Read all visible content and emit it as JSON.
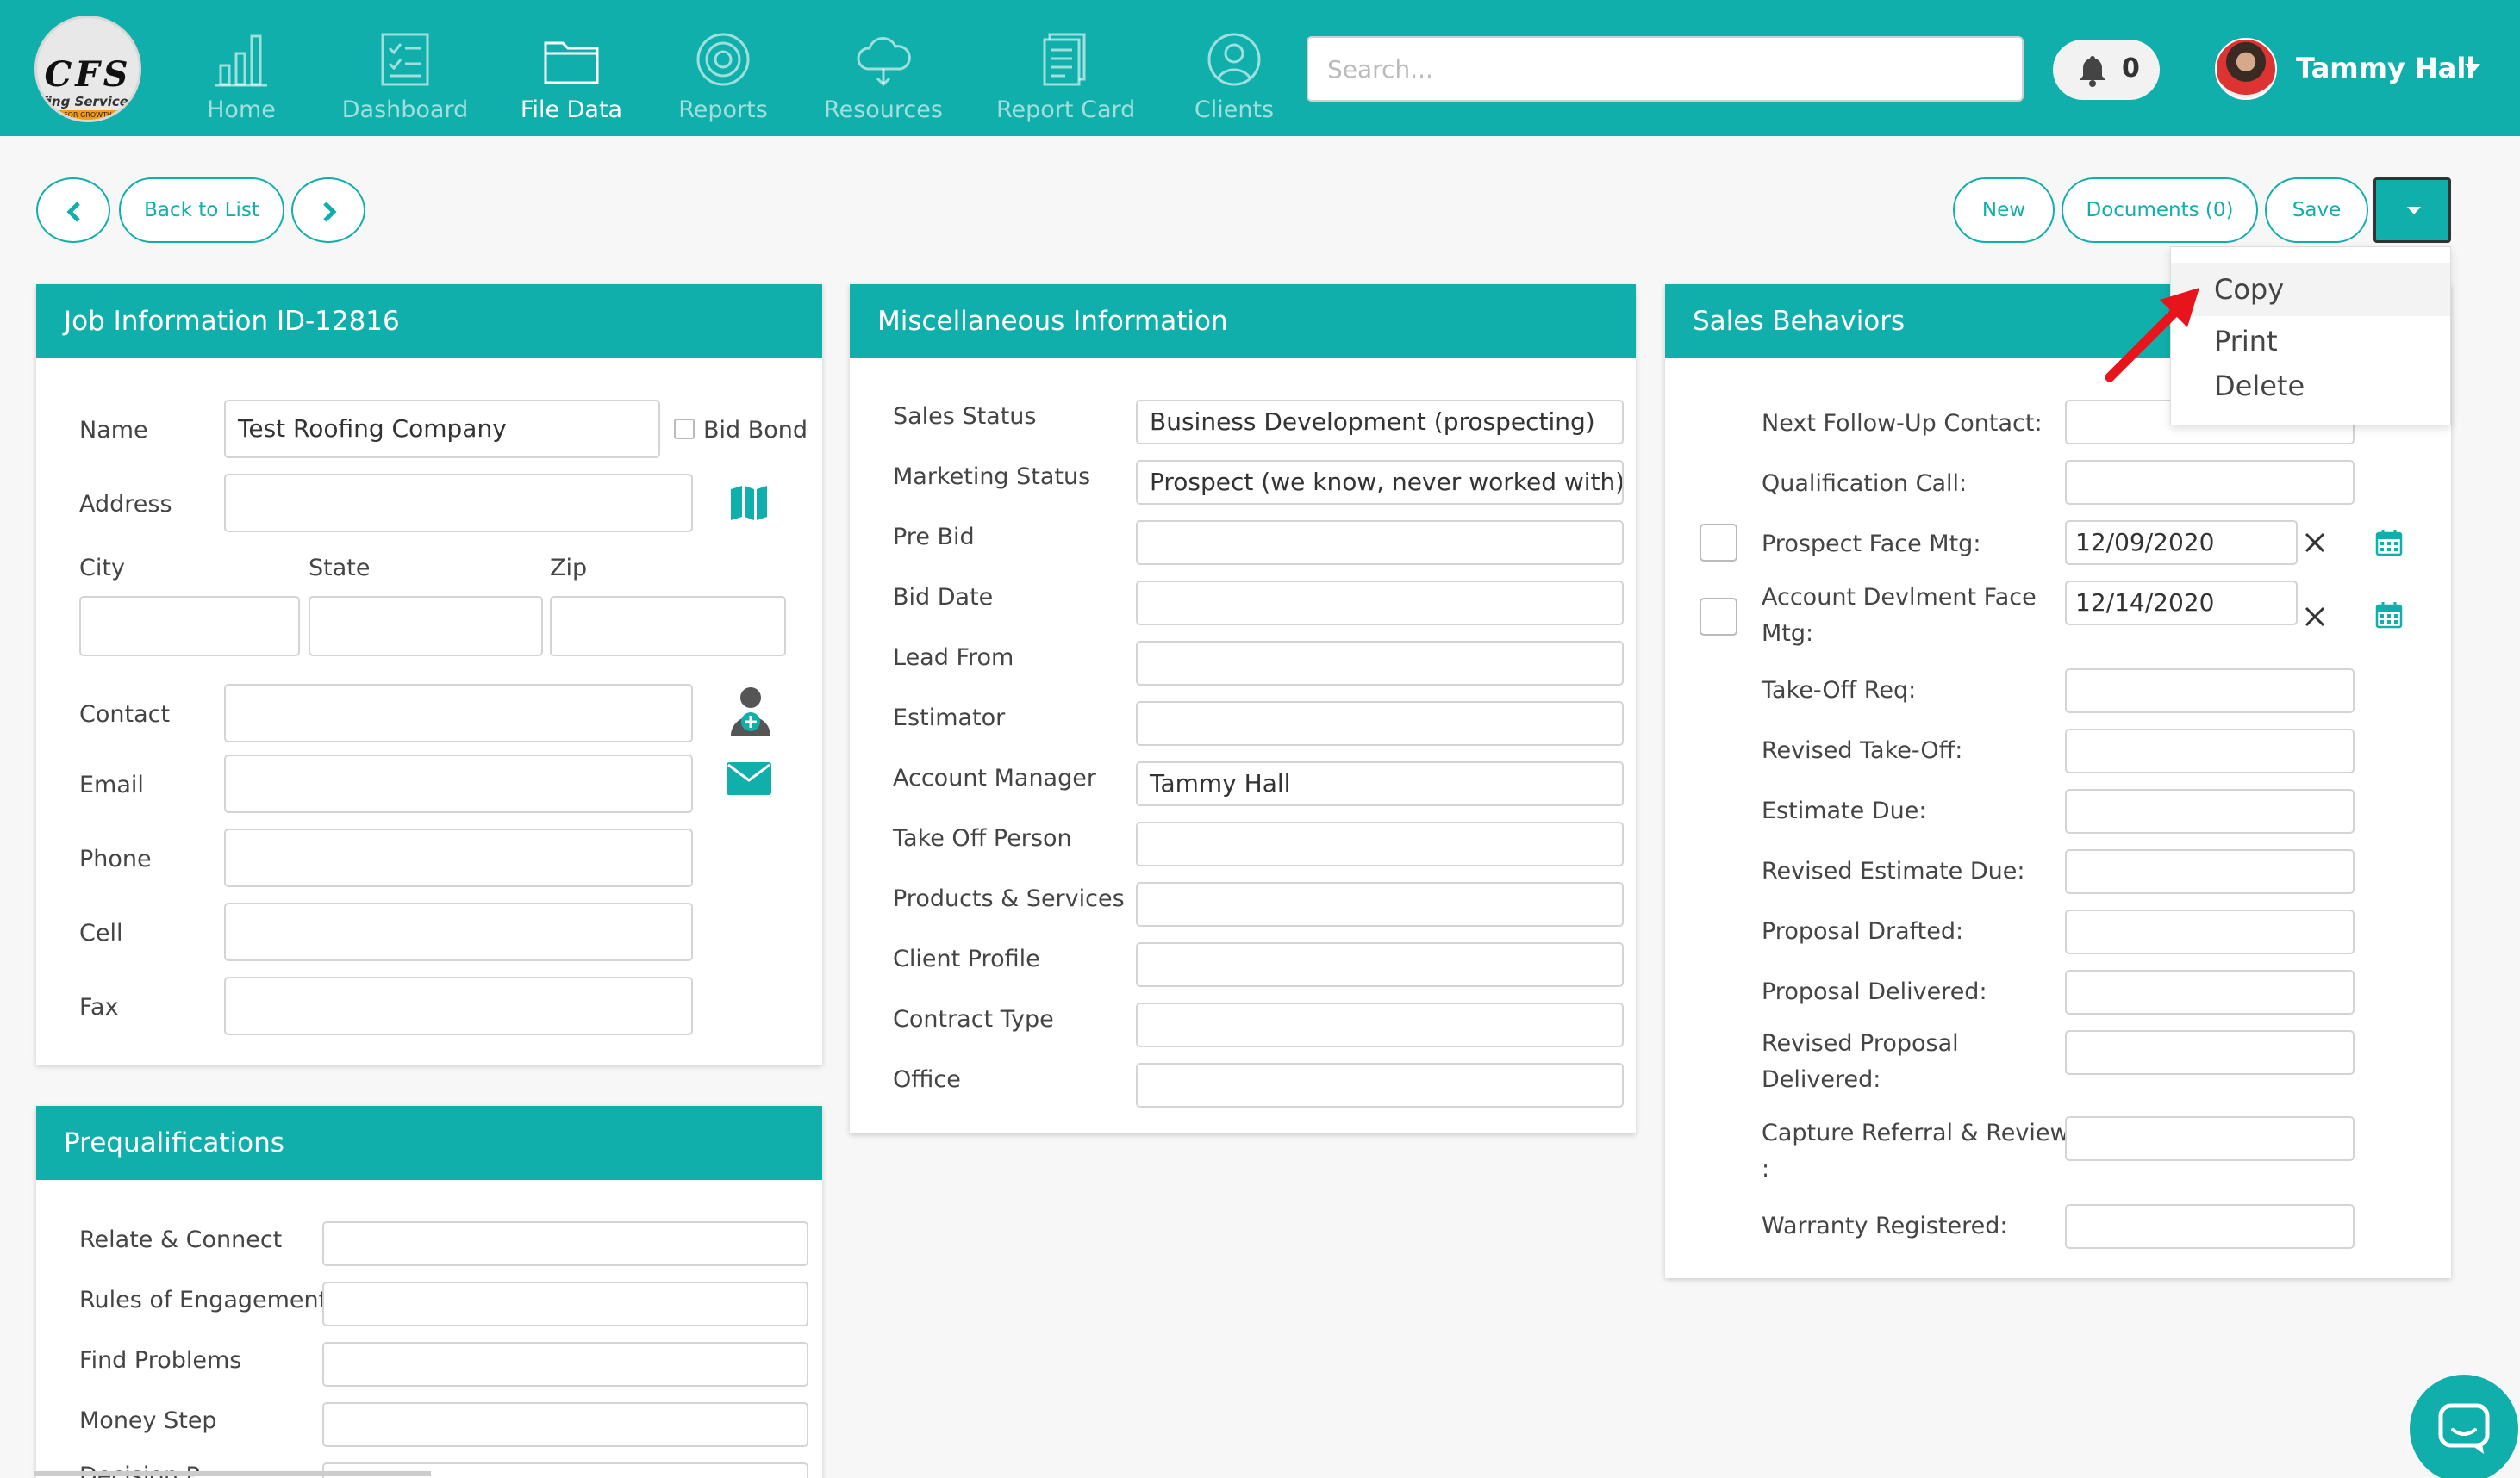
{
  "nav": {
    "logo_text": "CFS",
    "logo_subtext": "fing Services",
    "logo_band": "FOR GROWTH",
    "items": [
      {
        "label": "Home"
      },
      {
        "label": "Dashboard"
      },
      {
        "label": "File Data"
      },
      {
        "label": "Reports"
      },
      {
        "label": "Resources"
      },
      {
        "label": "Report Card"
      },
      {
        "label": "Clients"
      }
    ],
    "search_placeholder": "Search...",
    "notification_count": "0",
    "user_name": "Tammy Hall"
  },
  "toolbar": {
    "back_label": "Back to List",
    "new_label": "New",
    "documents_label": "Documents (0)",
    "save_label": "Save"
  },
  "menu": {
    "items": [
      {
        "label": "Copy"
      },
      {
        "label": "Print"
      },
      {
        "label": "Delete"
      }
    ]
  },
  "job": {
    "title": "Job Information ID-12816",
    "name_label": "Name",
    "name_value": "Test Roofing Company",
    "bid_bond_label": "Bid Bond",
    "address_label": "Address",
    "city_label": "City",
    "state_label": "State",
    "zip_label": "Zip",
    "contact_label": "Contact",
    "email_label": "Email",
    "phone_label": "Phone",
    "cell_label": "Cell",
    "fax_label": "Fax"
  },
  "prequal": {
    "title": "Prequalifications",
    "rows": [
      {
        "label": "Relate & Connect"
      },
      {
        "label": "Rules of Engagement"
      },
      {
        "label": "Find Problems"
      },
      {
        "label": "Money Step"
      },
      {
        "label": "Decision P..."
      }
    ]
  },
  "misc": {
    "title": "Miscellaneous Information",
    "rows": [
      {
        "label": "Sales Status",
        "value": "Business Development (prospecting)"
      },
      {
        "label": "Marketing Status",
        "value": "Prospect (we know, never worked with)"
      },
      {
        "label": "Pre Bid",
        "value": ""
      },
      {
        "label": "Bid Date",
        "value": ""
      },
      {
        "label": "Lead From",
        "value": ""
      },
      {
        "label": "Estimator",
        "value": ""
      },
      {
        "label": "Account Manager",
        "value": "Tammy Hall"
      },
      {
        "label": "Take Off Person",
        "value": ""
      },
      {
        "label": "Products & Services",
        "value": ""
      },
      {
        "label": "Client Profile",
        "value": ""
      },
      {
        "label": "Contract Type",
        "value": ""
      },
      {
        "label": "Office",
        "value": ""
      }
    ]
  },
  "sales": {
    "title": "Sales Behaviors",
    "rows": [
      {
        "label": "Next Follow-Up Contact:",
        "value": ""
      },
      {
        "label": "Qualification Call:",
        "value": ""
      },
      {
        "label": "Prospect Face Mtg:",
        "value": "12/09/2020"
      },
      {
        "label": "Account Devlment Face",
        "label2": "Mtg:",
        "value": "12/14/2020"
      },
      {
        "label": "Take-Off Req:",
        "value": ""
      },
      {
        "label": "Revised Take-Off:",
        "value": ""
      },
      {
        "label": "Estimate Due:",
        "value": ""
      },
      {
        "label": "Revised Estimate Due:",
        "value": ""
      },
      {
        "label": "Proposal Drafted:",
        "value": ""
      },
      {
        "label": "Proposal Delivered:",
        "value": ""
      },
      {
        "label": "Revised Proposal",
        "label2": "Delivered:",
        "value": ""
      },
      {
        "label": "Capture Referral & Review",
        "label2": ":",
        "value": ""
      },
      {
        "label": "Warranty Registered:",
        "value": ""
      }
    ]
  },
  "colors": {
    "accent": "#11afab",
    "arrow": "#e8141c"
  }
}
